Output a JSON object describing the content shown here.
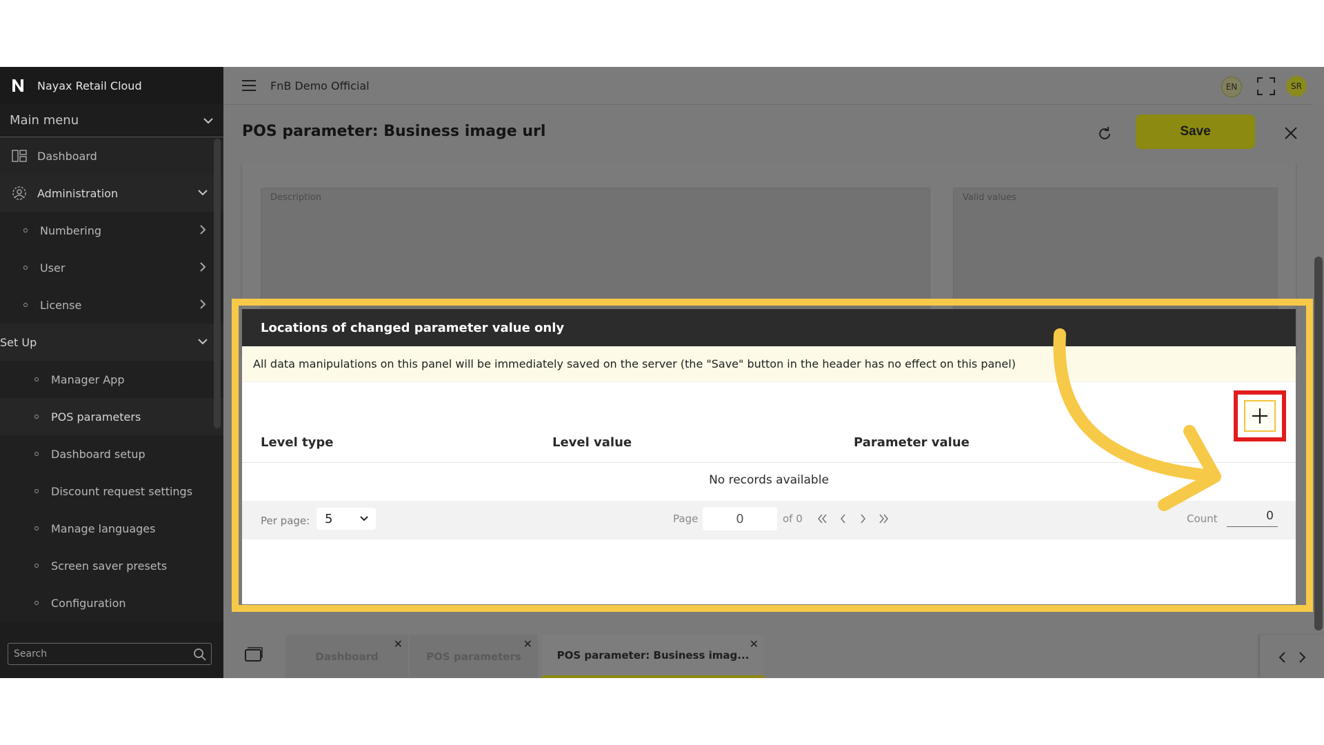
{
  "app": {
    "brand": "Nayax Retail Cloud",
    "company": "FnB Demo Official",
    "language": "EN",
    "user_initials": "SR"
  },
  "sidebar": {
    "main_menu": "Main menu",
    "items": [
      {
        "label": "Dashboard"
      },
      {
        "label": "Administration"
      },
      {
        "label": "Numbering"
      },
      {
        "label": "User"
      },
      {
        "label": "License"
      },
      {
        "label": "Set Up"
      },
      {
        "label": "Manager App"
      },
      {
        "label": "POS parameters"
      },
      {
        "label": "Dashboard setup"
      },
      {
        "label": "Discount request settings"
      },
      {
        "label": "Manage languages"
      },
      {
        "label": "Screen saver presets"
      },
      {
        "label": "Configuration"
      }
    ],
    "search_placeholder": "Search"
  },
  "page": {
    "title": "POS parameter: Business image url",
    "save_label": "Save",
    "description_label": "Description",
    "valid_values_label": "Valid values"
  },
  "panel": {
    "title": "Locations of changed parameter value only",
    "note": "All data manipulations on this panel will be immediately saved on the server (the \"Save\" button in the header has no effect on this panel)",
    "columns": [
      "Level type",
      "Level value",
      "Parameter value"
    ],
    "empty_text": "No records available",
    "per_page_label": "Per page:",
    "per_page_value": "5",
    "page_label": "Page",
    "page_value": "0",
    "of_label": "of 0",
    "count_label": "Count",
    "count_value": "0"
  },
  "tabs": [
    {
      "label": "Dashboard"
    },
    {
      "label": "POS parameters"
    },
    {
      "label": "POS parameter: Business imag..."
    }
  ],
  "colors": {
    "highlight": "#f7c948",
    "add_box": "#e21c1c",
    "save": "#8c8a10"
  }
}
